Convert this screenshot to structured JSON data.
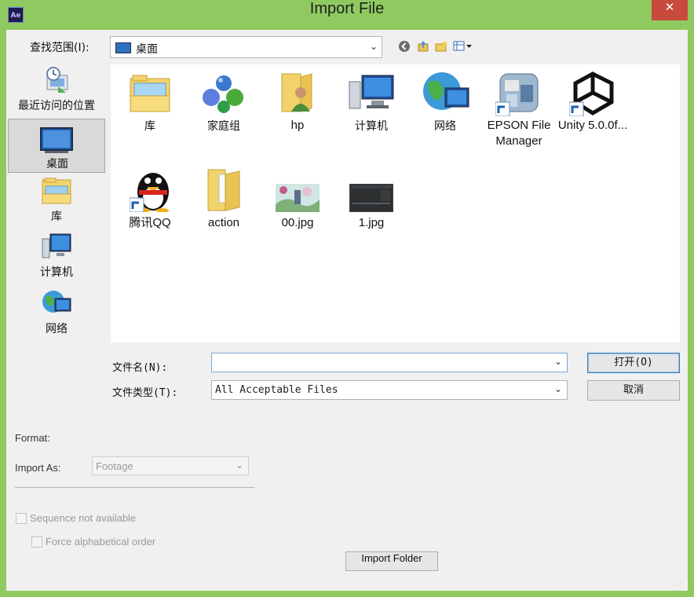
{
  "window": {
    "title": "Import File",
    "app_icon_text": "Ae",
    "close_glyph": "✕",
    "frame_color": "#8fca61"
  },
  "lookin": {
    "label": "查找范围(I):",
    "value": "桌面",
    "toolbar_icons": [
      "back-icon",
      "up-folder-icon",
      "new-folder-icon",
      "view-menu-icon"
    ]
  },
  "places": [
    {
      "label": "最近访问的位置",
      "icon": "recent-places-icon",
      "selected": false
    },
    {
      "label": "桌面",
      "icon": "desktop-icon",
      "selected": true
    },
    {
      "label": "库",
      "icon": "libraries-icon",
      "selected": false
    },
    {
      "label": "计算机",
      "icon": "computer-icon",
      "selected": false
    },
    {
      "label": "网络",
      "icon": "network-icon",
      "selected": false
    }
  ],
  "files": [
    {
      "label": "库",
      "icon": "libraries-icon"
    },
    {
      "label": "家庭组",
      "icon": "homegroup-icon"
    },
    {
      "label": "hp",
      "icon": "user-folder-icon"
    },
    {
      "label": "计算机",
      "icon": "computer-icon"
    },
    {
      "label": "网络",
      "icon": "network-icon"
    },
    {
      "label": "EPSON File Manager",
      "icon": "epson-shortcut-icon"
    },
    {
      "label": "Unity 5.0.0f...",
      "icon": "unity-shortcut-icon"
    },
    {
      "label": "腾讯QQ",
      "icon": "qq-shortcut-icon"
    },
    {
      "label": "action",
      "icon": "folder-icon"
    },
    {
      "label": "00.jpg",
      "icon": "image-thumbnail-icon"
    },
    {
      "label": "1.jpg",
      "icon": "image-thumbnail-icon"
    }
  ],
  "filename": {
    "label": "文件名(N):",
    "value": ""
  },
  "filetype": {
    "label": "文件类型(T):",
    "value": "All Acceptable Files"
  },
  "buttons": {
    "open": "打开(O)",
    "cancel": "取消",
    "import_folder": "Import Folder"
  },
  "options": {
    "format_label": "Format:",
    "import_as_label": "Import As:",
    "import_as_value": "Footage",
    "sequence_label": "Sequence not available",
    "sequence_checked": false,
    "force_alpha_label": "Force alphabetical order",
    "force_alpha_checked": false
  }
}
